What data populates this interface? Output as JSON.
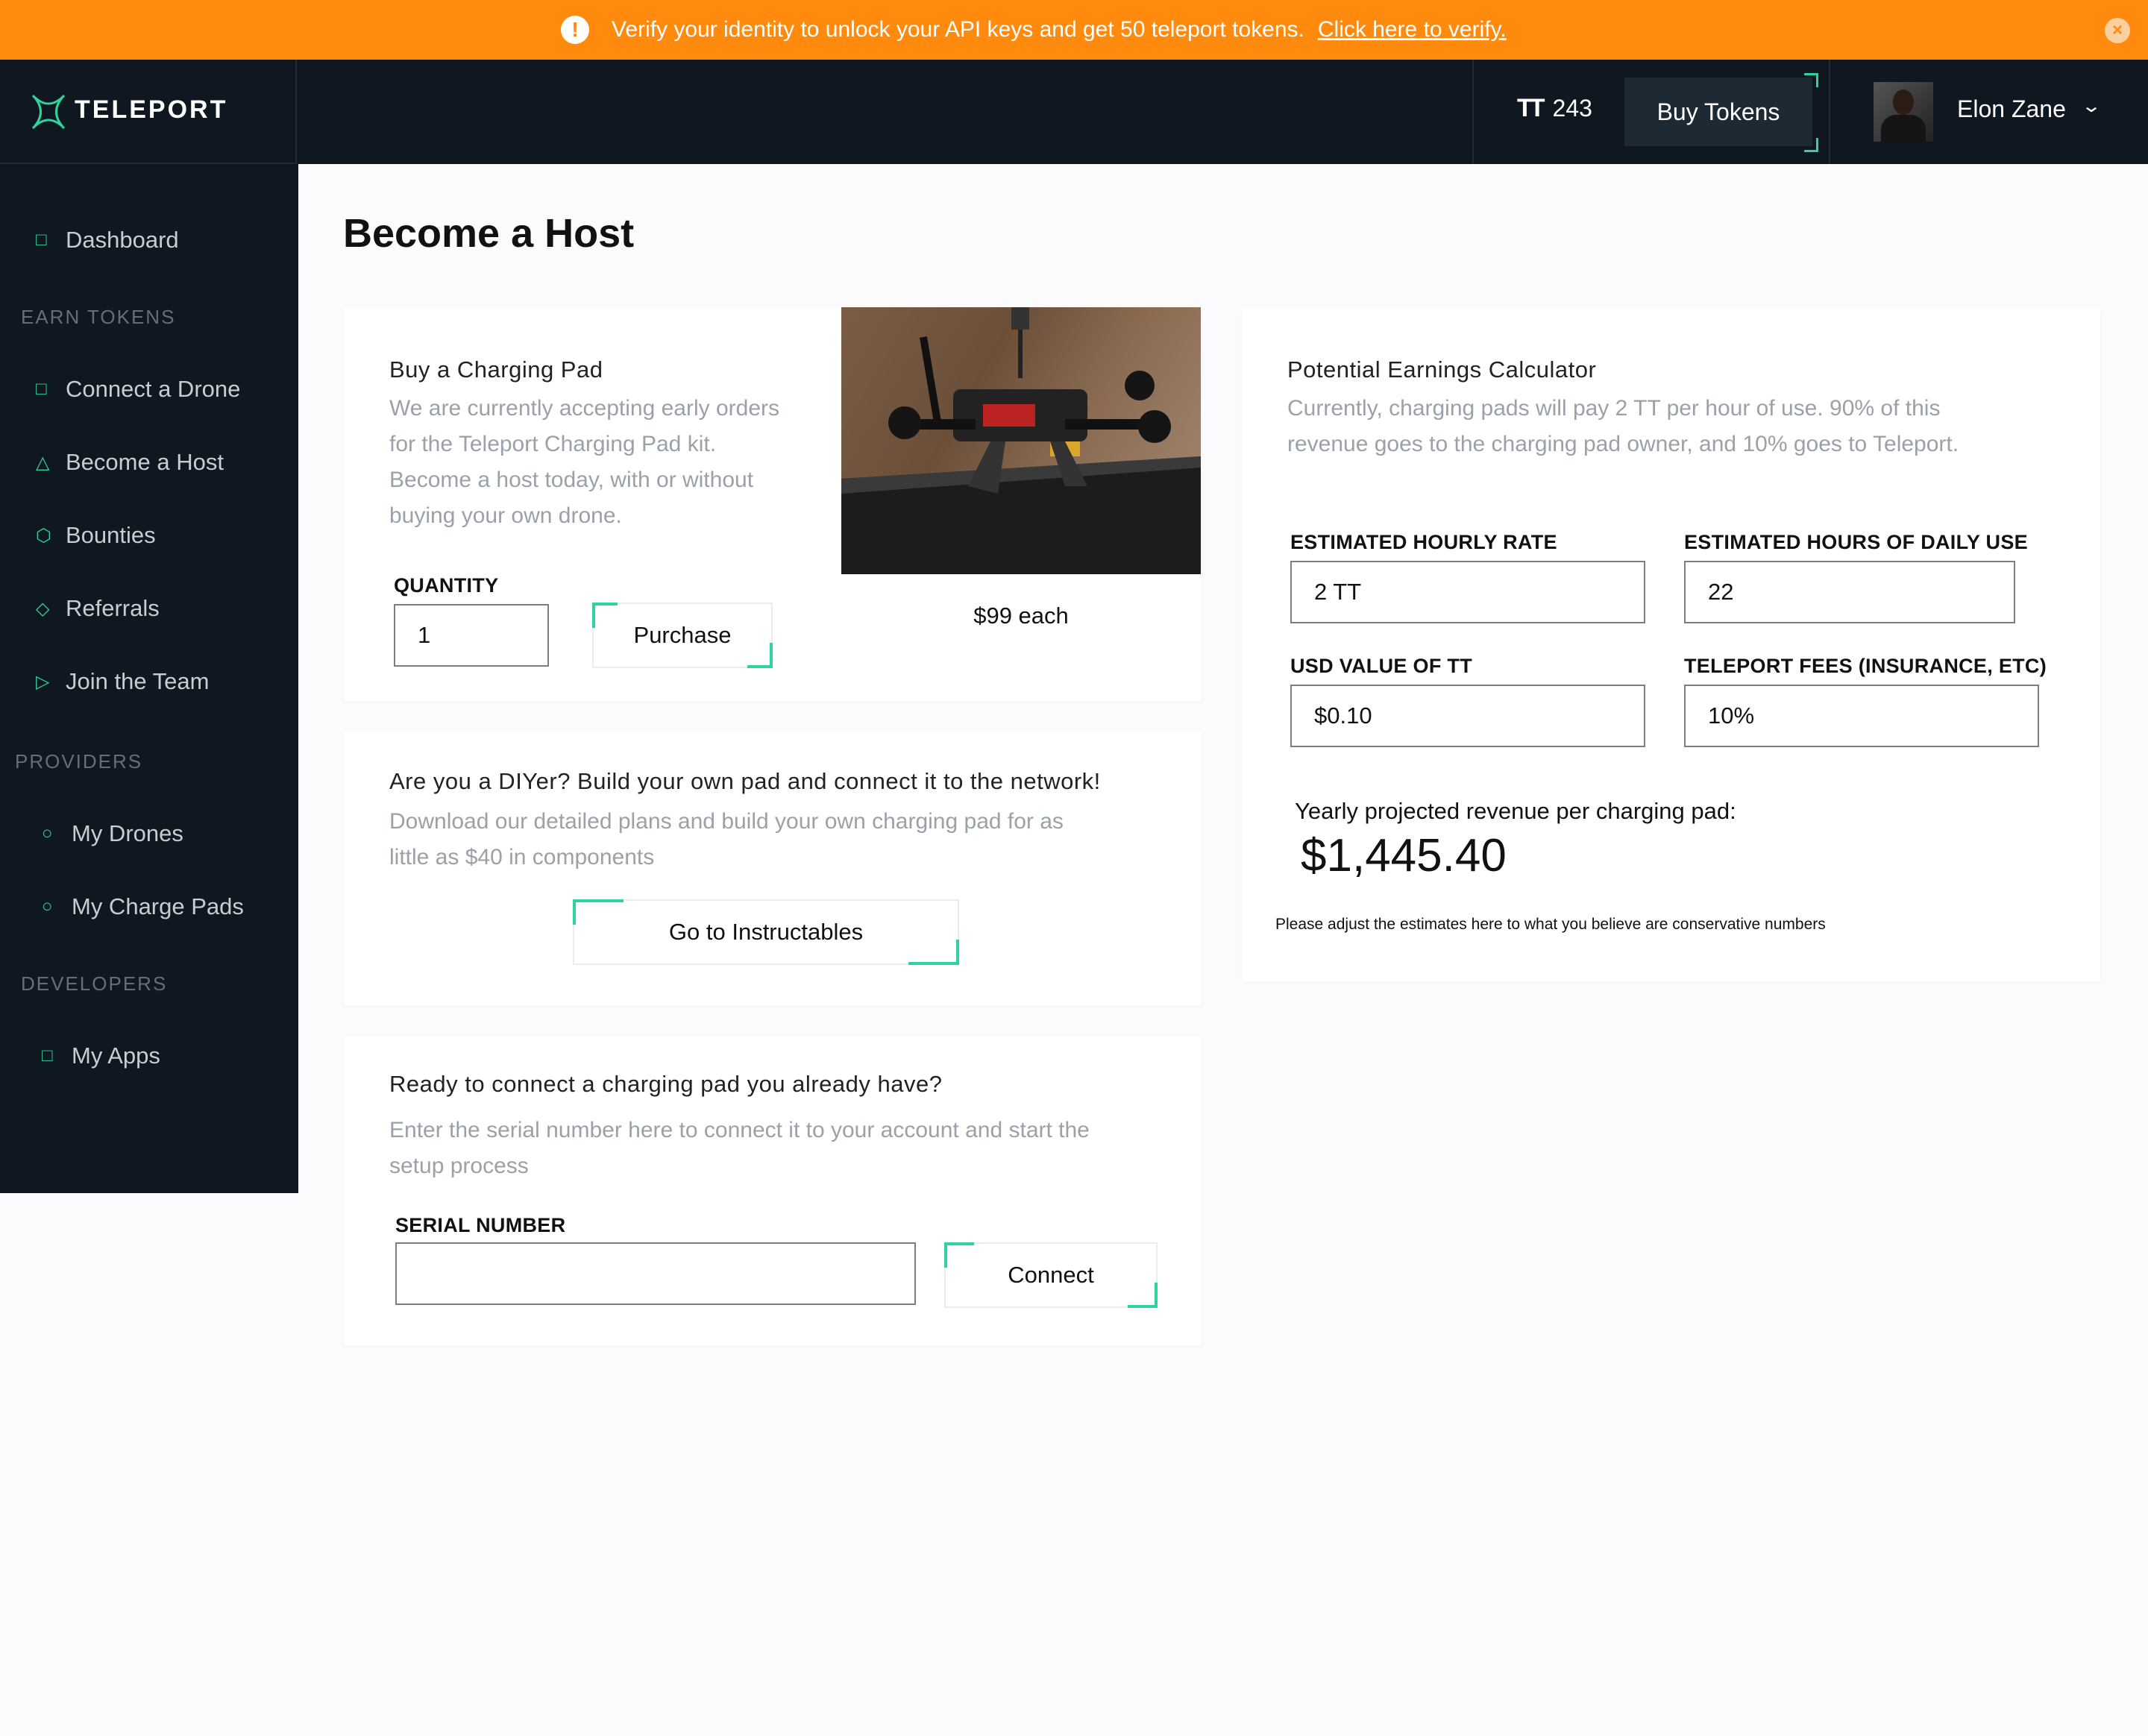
{
  "banner": {
    "message": "Verify your identity to unlock your API keys and get 50 teleport tokens.",
    "link": "Click here to verify.",
    "alert_icon": "!",
    "close_icon": "×"
  },
  "header": {
    "logo_text": "TELEPORT",
    "token_symbol": "TT",
    "token_balance": "243",
    "buy_button": "Buy Tokens",
    "user_name": "Elon Zane",
    "chevron": "⌄"
  },
  "sidebar": {
    "dashboard": "Dashboard",
    "section_earn": "EARN TOKENS",
    "connect_drone": "Connect a Drone",
    "become_host": "Become a Host",
    "bounties": "Bounties",
    "referrals": "Referrals",
    "join_team": "Join the Team",
    "section_providers": "PROVIDERS",
    "my_drones": "My Drones",
    "my_charge_pads": "My Charge Pads",
    "section_developers": "DEVELOPERS",
    "my_apps": "My Apps"
  },
  "page": {
    "title": "Become a Host"
  },
  "buy_pad": {
    "title": "Buy a Charging Pad",
    "line1": "We are currently accepting early orders",
    "line2": "for the Teleport Charging Pad kit.",
    "line3": "Become a host today, with or without",
    "line4": "buying your own drone.",
    "quantity_label": "QUANTITY",
    "quantity_value": "1",
    "purchase_button": "Purchase",
    "price": "$99 each"
  },
  "diy": {
    "title": "Are you a DIYer? Build your own pad and connect it to the network!",
    "line1": "Download our detailed plans and build your own charging pad for as",
    "line2": "little as $40 in components",
    "button": "Go to Instructables"
  },
  "connect_pad": {
    "title": "Ready to connect a charging pad you already have?",
    "line1": "Enter the serial number here to connect it to your account and start the",
    "line2": "setup process",
    "serial_label": "SERIAL NUMBER",
    "serial_value": "",
    "button": "Connect"
  },
  "calculator": {
    "title": "Potential Earnings Calculator",
    "line1": "Currently, charging pads will pay 2 TT per hour of use. 90% of this",
    "line2": "revenue goes to the charging pad owner, and 10% goes to Teleport.",
    "hourly_rate_label": "ESTIMATED HOURLY RATE",
    "hourly_rate_value": "2 TT",
    "daily_hours_label": "ESTIMATED HOURS OF DAILY USE",
    "daily_hours_value": "22",
    "usd_label": "USD VALUE OF TT",
    "usd_value": "$0.10",
    "fees_label": "TELEPORT FEES (INSURANCE, ETC)",
    "fees_value": "10%",
    "result_label": "Yearly projected revenue per charging pad:",
    "result_value": "$1,445.40",
    "note": "Please adjust the estimates here to what you believe are conservative numbers"
  },
  "colors": {
    "accent": "#2ed3a0",
    "banner": "#ff8a0d",
    "nav_bg": "#0f1820"
  }
}
